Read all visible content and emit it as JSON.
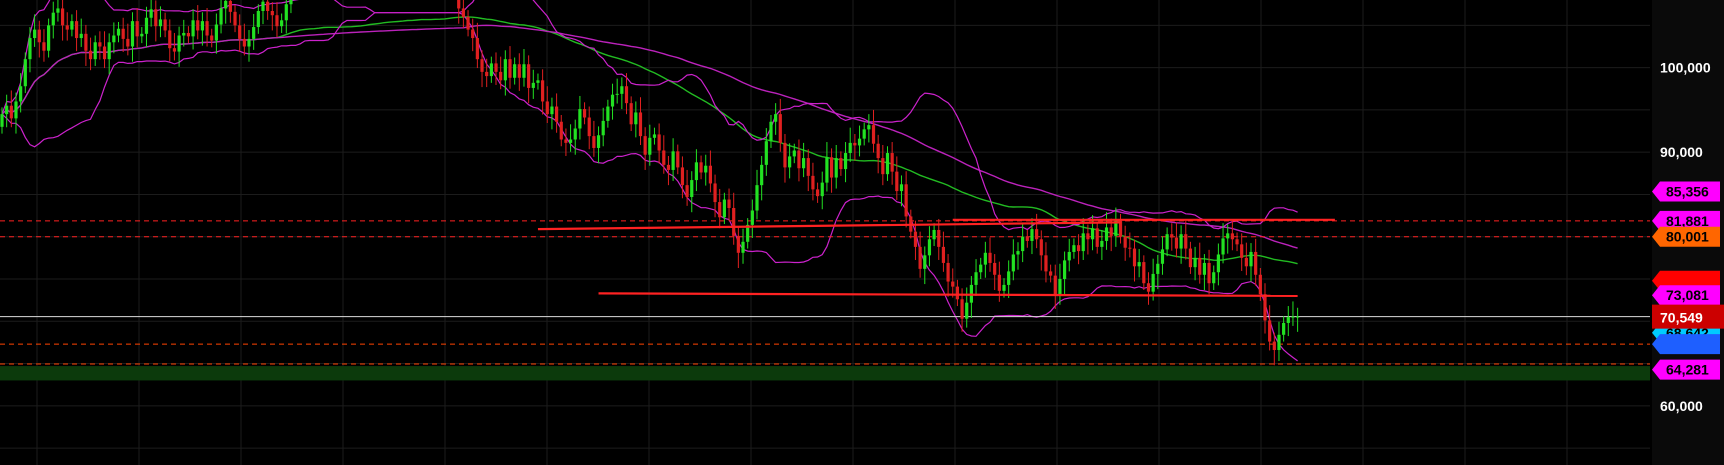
{
  "colors": {
    "background": "#000000",
    "grid": "#1c1c1c",
    "axis_panel": "#0a0a0a",
    "candle_up": "#22e222",
    "candle_down": "#e02020",
    "bollinger": "#cc22cc",
    "ma_green": "#22bb22",
    "ma_magenta": "#bb22bb",
    "red_level": "#ff2222",
    "support_band": "#0c3a0c"
  },
  "chart_data": {
    "type": "candlestick",
    "title": "",
    "xlabel": "",
    "ylabel": "",
    "y_axis_side": "right",
    "ylim": [
      53000,
      108000
    ],
    "grid": true,
    "y_ticks": [
      {
        "value": 100000,
        "label": "100,000"
      },
      {
        "value": 90000,
        "label": "90,000"
      },
      {
        "value": 60000,
        "label": "60,000"
      }
    ],
    "current_price": {
      "value": 70549,
      "label": "70,549",
      "color": "#cc0000"
    },
    "price_tags": [
      {
        "value": 85356,
        "label": "85,356",
        "color": "#ff00ff",
        "text_color": "#000000"
      },
      {
        "value": 81881,
        "label": "81,881",
        "color": "#ff00ff",
        "text_color": "#000000"
      },
      {
        "value": 80001,
        "label": "80,001",
        "color": "#ff6600",
        "text_color": "#000000"
      },
      {
        "value": 74800,
        "label": "",
        "color": "#ff0000",
        "text_color": "#000000"
      },
      {
        "value": 73081,
        "label": "73,081",
        "color": "#ff00ff",
        "text_color": "#000000"
      },
      {
        "value": 68642,
        "label": "68,642",
        "color": "#00ccff",
        "text_color": "#000000"
      },
      {
        "value": 67300,
        "label": "",
        "color": "#1e5fff",
        "text_color": "#000000"
      },
      {
        "value": 64281,
        "label": "64,281",
        "color": "#ff00ff",
        "text_color": "#000000"
      }
    ],
    "horizontal_levels": [
      {
        "value": 81881,
        "style": "dashed",
        "color": "#ff2222"
      },
      {
        "value": 80001,
        "style": "dashed",
        "color": "#ff2222"
      },
      {
        "value": 67300,
        "style": "dashed",
        "color": "#ff4400"
      },
      {
        "value": 64950,
        "style": "dashed",
        "color": "#ff4400"
      },
      {
        "value": 70549,
        "style": "solid",
        "color": "#dddddd"
      }
    ],
    "support_band": [
      63000,
      64700
    ],
    "series": [
      {
        "kind": "ohlc",
        "x": [
          1,
          2,
          3,
          4,
          5,
          6,
          7,
          8,
          9,
          10,
          11,
          12,
          13,
          14,
          15,
          16,
          17,
          18,
          19,
          20,
          21,
          22,
          23,
          24,
          25,
          26,
          27,
          28,
          29,
          30,
          31,
          32,
          33,
          34,
          35,
          36,
          37,
          38,
          39,
          40,
          41,
          42,
          43,
          44,
          45,
          46,
          47,
          48,
          49,
          50,
          51,
          52,
          53,
          54,
          55,
          56,
          57,
          58,
          59,
          60,
          61,
          62,
          63,
          64,
          65,
          66,
          67,
          68,
          69,
          70,
          71,
          72,
          73,
          74,
          75,
          76,
          77,
          78,
          79,
          80,
          81,
          82,
          83,
          84,
          85,
          86,
          87,
          88,
          89,
          90,
          91,
          92,
          93,
          94,
          95,
          96,
          97,
          98,
          99,
          100,
          101,
          102,
          103,
          104,
          105,
          106,
          107,
          108,
          109,
          110,
          111,
          112,
          113,
          114,
          115,
          116,
          117,
          118,
          119,
          120,
          121,
          122,
          123,
          124,
          125,
          126,
          127,
          128,
          129,
          130,
          131,
          132,
          133,
          134,
          135,
          136,
          137,
          138,
          139,
          140,
          141,
          142,
          143,
          144,
          145,
          146,
          147,
          148,
          149,
          150,
          151,
          152,
          153,
          154,
          155,
          156,
          157,
          158,
          159,
          160,
          161,
          162,
          163,
          164,
          165,
          166,
          167,
          168,
          169,
          170,
          171,
          172,
          173,
          174,
          175,
          176,
          177,
          178,
          179,
          180,
          181,
          182,
          183,
          184,
          185,
          186,
          187,
          188,
          189,
          190,
          191,
          192,
          193,
          194,
          195,
          196,
          197,
          198,
          199,
          200,
          201,
          202,
          203,
          204,
          205,
          206,
          207,
          208,
          209,
          210,
          211,
          212,
          213,
          214,
          215,
          216,
          217,
          218,
          219,
          220,
          221,
          222,
          223,
          224,
          225,
          226,
          227,
          228,
          229,
          230,
          231,
          232,
          233,
          234,
          235,
          236,
          237,
          238,
          239,
          240,
          241,
          242,
          243,
          244,
          245,
          246,
          247,
          248,
          249,
          250,
          251,
          252,
          253,
          254,
          255,
          256,
          257,
          258,
          259,
          260,
          261,
          262,
          263,
          264,
          265,
          266,
          267,
          268,
          269,
          270,
          271,
          272,
          273,
          274,
          275,
          276,
          277,
          278,
          279,
          280,
          281,
          282,
          283,
          284,
          285,
          286,
          287,
          288,
          289,
          290,
          291,
          292,
          293,
          294,
          295,
          296,
          297,
          298,
          299,
          300,
          301,
          302,
          303,
          304,
          305,
          306,
          307,
          308,
          309,
          310,
          311,
          312,
          313,
          314,
          315,
          316,
          317,
          318,
          319,
          320,
          321,
          322,
          323,
          324
        ],
        "open": [
          93000,
          94500,
          95500,
          94000,
          96000,
          97800,
          101000,
          103500,
          104500,
          103000,
          102000,
          105000,
          106500,
          107000,
          105000,
          104500,
          105500,
          103500,
          104000,
          102000,
          101000,
          103000,
          102500,
          101000,
          103000,
          103800,
          104600,
          103400,
          102500,
          105500,
          103700,
          104000,
          105900,
          106900,
          104900,
          105700,
          104400,
          102300,
          101900,
          103800,
          104100,
          103700,
          105600,
          104400,
          105500,
          103800,
          103200,
          105100,
          107000,
          107900,
          106600,
          105000,
          103400,
          102500,
          103400,
          104800,
          106700,
          107800,
          106700,
          106200,
          104900,
          105600,
          107500,
          108000,
          108000,
          108000,
          108000,
          108000,
          108000,
          108000,
          108000,
          108000,
          108000,
          108000,
          108000,
          108000,
          108000,
          108000,
          108000,
          108000,
          108000,
          108000,
          108000,
          108000,
          108000,
          108000,
          108000,
          108000,
          108000,
          108000,
          108000,
          108000,
          108000,
          108000,
          108000,
          108000,
          108000,
          108000,
          108000,
          107000,
          106000,
          104500,
          103500,
          101000,
          99500,
          99000,
          100500,
          99500,
          98500,
          101000,
          98800,
          100400,
          98800,
          100400,
          97600,
          98200,
          98500,
          96000,
          94500,
          95400,
          93600,
          91500,
          91100,
          91500,
          92800,
          95100,
          94100,
          91900,
          90500,
          92000,
          93700,
          95400,
          96800,
          96900,
          97800,
          95800,
          93300,
          94700,
          91900,
          89700,
          91700,
          92100,
          90200,
          88500,
          87900,
          90100,
          88200,
          86100,
          84700,
          86700,
          88800,
          87600,
          88400,
          86300,
          84100,
          82300,
          84400,
          83400,
          80100,
          78100,
          79400,
          81400,
          83100,
          86100,
          88500,
          91300,
          93600,
          94500,
          91100,
          88200,
          89500,
          90200,
          88100,
          89300,
          87200,
          85600,
          84800,
          86400,
          89400,
          87000,
          89300,
          88000,
          89900,
          91100,
          90800,
          91600,
          92700,
          93200,
          91000,
          89300,
          87400,
          89900,
          87700,
          85400,
          86200,
          82400,
          80600,
          78800,
          76200,
          77800,
          79700,
          80800,
          78800,
          76900,
          74700,
          74100,
          72600,
          70300,
          72200,
          74300,
          75800,
          76700,
          78100,
          76900,
          75500,
          73600,
          74300,
          75900,
          77900,
          78300,
          80000,
          79500,
          80900,
          79700,
          77800,
          75900,
          75400,
          73000,
          75000,
          77200,
          78200,
          79000,
          78300,
          80400,
          79700,
          81000,
          78800,
          79500,
          81100,
          80100,
          81900,
          80000,
          78700,
          78600,
          76500,
          77000,
          74500,
          73500,
          75600,
          76800,
          78500,
          80300,
          79900,
          78600,
          80300,
          78600,
          76400,
          77500,
          75500,
          76900,
          74500,
          75800,
          77900,
          79800,
          80400,
          79700,
          79100,
          77500,
          76500,
          78200,
          75500,
          73200,
          70100,
          67600,
          66600,
          68400,
          69800,
          70500,
          70549
        ],
        "close": [
          94500,
          95500,
          94000,
          96000,
          97800,
          101000,
          103500,
          104500,
          103000,
          102000,
          105000,
          106500,
          107000,
          105000,
          104500,
          105500,
          103500,
          104000,
          102000,
          101000,
          103000,
          102500,
          101000,
          103000,
          103800,
          104600,
          103400,
          102500,
          105500,
          103700,
          104000,
          105900,
          106900,
          104900,
          105700,
          104400,
          102300,
          101900,
          103800,
          104100,
          103700,
          105600,
          104400,
          105500,
          103800,
          103200,
          105100,
          107000,
          107900,
          106600,
          105000,
          103400,
          102500,
          103400,
          104800,
          106700,
          107800,
          106700,
          106200,
          104900,
          105600,
          107500,
          108000,
          108000,
          108000,
          108000,
          108000,
          108000,
          108000,
          108000,
          108000,
          108000,
          108000,
          108000,
          108000,
          108000,
          108000,
          108000,
          108000,
          108000,
          108000,
          108000,
          108000,
          108000,
          108000,
          108000,
          108000,
          108000,
          108000,
          108000,
          108000,
          108000,
          108000,
          108000,
          108000,
          108000,
          108000,
          108000,
          107000,
          106000,
          104500,
          103500,
          101000,
          99500,
          99000,
          100500,
          99500,
          98500,
          101000,
          98800,
          100400,
          98800,
          100400,
          97600,
          98200,
          98500,
          96000,
          94500,
          95400,
          93600,
          91500,
          91100,
          91500,
          92800,
          95100,
          94100,
          91900,
          90500,
          92000,
          93700,
          95400,
          96800,
          96900,
          97800,
          95800,
          93300,
          94700,
          91900,
          89700,
          91700,
          92100,
          90200,
          88500,
          87900,
          90100,
          88200,
          86100,
          84700,
          86700,
          88800,
          87600,
          88400,
          86300,
          84100,
          82300,
          84400,
          83400,
          80100,
          78100,
          79400,
          81400,
          83100,
          86100,
          88500,
          91300,
          93600,
          94500,
          91100,
          88200,
          89500,
          90200,
          88100,
          89300,
          87200,
          85600,
          84800,
          86400,
          89400,
          87000,
          89300,
          88000,
          89900,
          91100,
          90800,
          91600,
          92700,
          93200,
          91000,
          89300,
          87400,
          89900,
          87700,
          85400,
          86200,
          82400,
          80600,
          78800,
          76200,
          77800,
          79700,
          80800,
          78800,
          76900,
          74700,
          74100,
          72600,
          70300,
          72200,
          74300,
          75800,
          76700,
          78100,
          76900,
          75500,
          73600,
          74300,
          75900,
          77900,
          78300,
          80000,
          79500,
          80900,
          79700,
          77800,
          75900,
          75400,
          73000,
          75000,
          77200,
          78200,
          79000,
          78300,
          80400,
          79700,
          81000,
          78800,
          79500,
          81100,
          80100,
          81900,
          80000,
          78700,
          78600,
          76500,
          77000,
          74500,
          73500,
          75600,
          76800,
          78500,
          80300,
          79900,
          78600,
          80300,
          78600,
          76400,
          77500,
          75500,
          76900,
          74500,
          75800,
          77900,
          79800,
          80400,
          79700,
          79100,
          77500,
          76500,
          78200,
          75500,
          73200,
          70100,
          67600,
          66600,
          68400,
          69800,
          70500,
          70549,
          70549
        ]
      }
    ],
    "indicators": [
      {
        "name": "",
        "kind": "bollinger",
        "color": "#cc22cc"
      },
      {
        "name": "",
        "kind": "moving_average",
        "color": "#22bb22"
      },
      {
        "name": "",
        "kind": "moving_average",
        "color": "#bb22bb"
      }
    ],
    "drawn_lines": [
      {
        "kind": "red_trend",
        "points": [
          [
            116,
            80900
          ],
          [
            241,
            81700
          ]
        ]
      },
      {
        "kind": "red_trend",
        "points": [
          [
            129,
            73300
          ],
          [
            279,
            73000
          ]
        ]
      },
      {
        "kind": "red_trend",
        "points": [
          [
            205,
            82000
          ],
          [
            287,
            82000
          ]
        ]
      }
    ]
  }
}
